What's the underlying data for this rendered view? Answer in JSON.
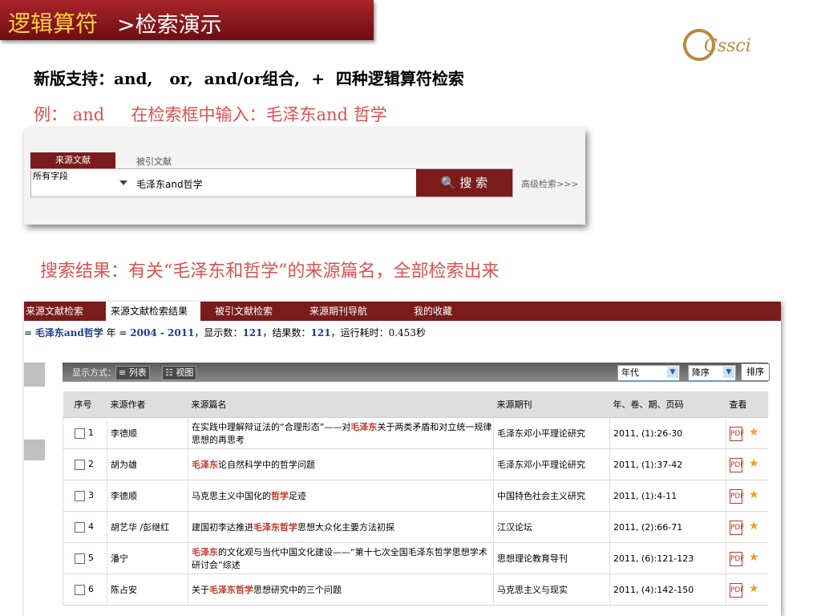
{
  "title": {
    "part1": "逻辑算符",
    "part2": ">检索演示"
  },
  "logo": {
    "text": "Cssci"
  },
  "intro": {
    "line1": "新版支持：and,   or,  and/or组合,  +  四种逻辑算符检索",
    "line2": "例： and     在检索框中输入：毛泽东and 哲学"
  },
  "search": {
    "tab_active": "来源文献",
    "tab_inactive": "被引文献",
    "field": "所有字段",
    "query": "毛泽东and哲学",
    "button": "搜 索",
    "advanced": "高级检索>>>"
  },
  "result_caption": "搜索结果：有关“毛泽东和哲学”的来源篇名，全部检索出来",
  "nav": [
    "来源文献检索",
    "来源文献检索结果",
    "被引文献检索",
    "来源期刊导航",
    "我的收藏"
  ],
  "summary": {
    "prefix": "= ",
    "query": "毛泽东and哲学",
    "year_label": " 年 = ",
    "year_value": "2004 - 2011",
    "shown_label": "，显示数：",
    "shown": "121",
    "result_label": "，结果数：",
    "result": "121",
    "time_label": "，运行耗时：",
    "time": "0.453秒"
  },
  "display": {
    "label": "显示方式：",
    "list": "列表",
    "view": "视图",
    "sort_field": "年代",
    "sort_order": "降序",
    "sort_button": "排序"
  },
  "table": {
    "headers": [
      "序号",
      "来源作者",
      "来源篇名",
      "来源期刊",
      "年、卷、期、页码",
      "查看"
    ],
    "rows": [
      {
        "no": "1",
        "author": "李德顺",
        "title_pre": "在实践中理解辩证法的“合理形态”——对",
        "hl": "毛泽东",
        "title_post": "关于两类矛盾和对立统一规律思想的再思考",
        "journal": "毛泽东邓小平理论研究",
        "pages": "2011, (1):26-30"
      },
      {
        "no": "2",
        "author": "胡为雄",
        "title_pre": "",
        "hl": "毛泽东",
        "title_post": "论自然科学中的哲学问题",
        "journal": "毛泽东邓小平理论研究",
        "pages": "2011, (1):37-42"
      },
      {
        "no": "3",
        "author": "李德顺",
        "title_pre": "马克思主义中国化的",
        "hl": "哲学",
        "title_post": "足迹",
        "journal": "中国特色社会主义研究",
        "pages": "2011, (1):4-11"
      },
      {
        "no": "4",
        "author": "胡艺华 /彭继红",
        "title_pre": "建国初李达推进",
        "hl": "毛泽东哲学",
        "title_post": "思想大众化主要方法初探",
        "journal": "江汉论坛",
        "pages": "2011, (2):66-71"
      },
      {
        "no": "5",
        "author": "潘宁",
        "title_pre": "",
        "hl": "毛泽东",
        "title_post": "的文化观与当代中国文化建设——“第十七次全国毛泽东哲学思想学术研讨会”综述",
        "journal": "思想理论教育导刊",
        "pages": "2011, (6):121-123"
      },
      {
        "no": "6",
        "author": "陈占安",
        "title_pre": "关于",
        "hl": "毛泽东哲学",
        "title_post": "思想研究中的三个问题",
        "journal": "马克思主义与现实",
        "pages": "2011, (4):142-150"
      }
    ]
  }
}
